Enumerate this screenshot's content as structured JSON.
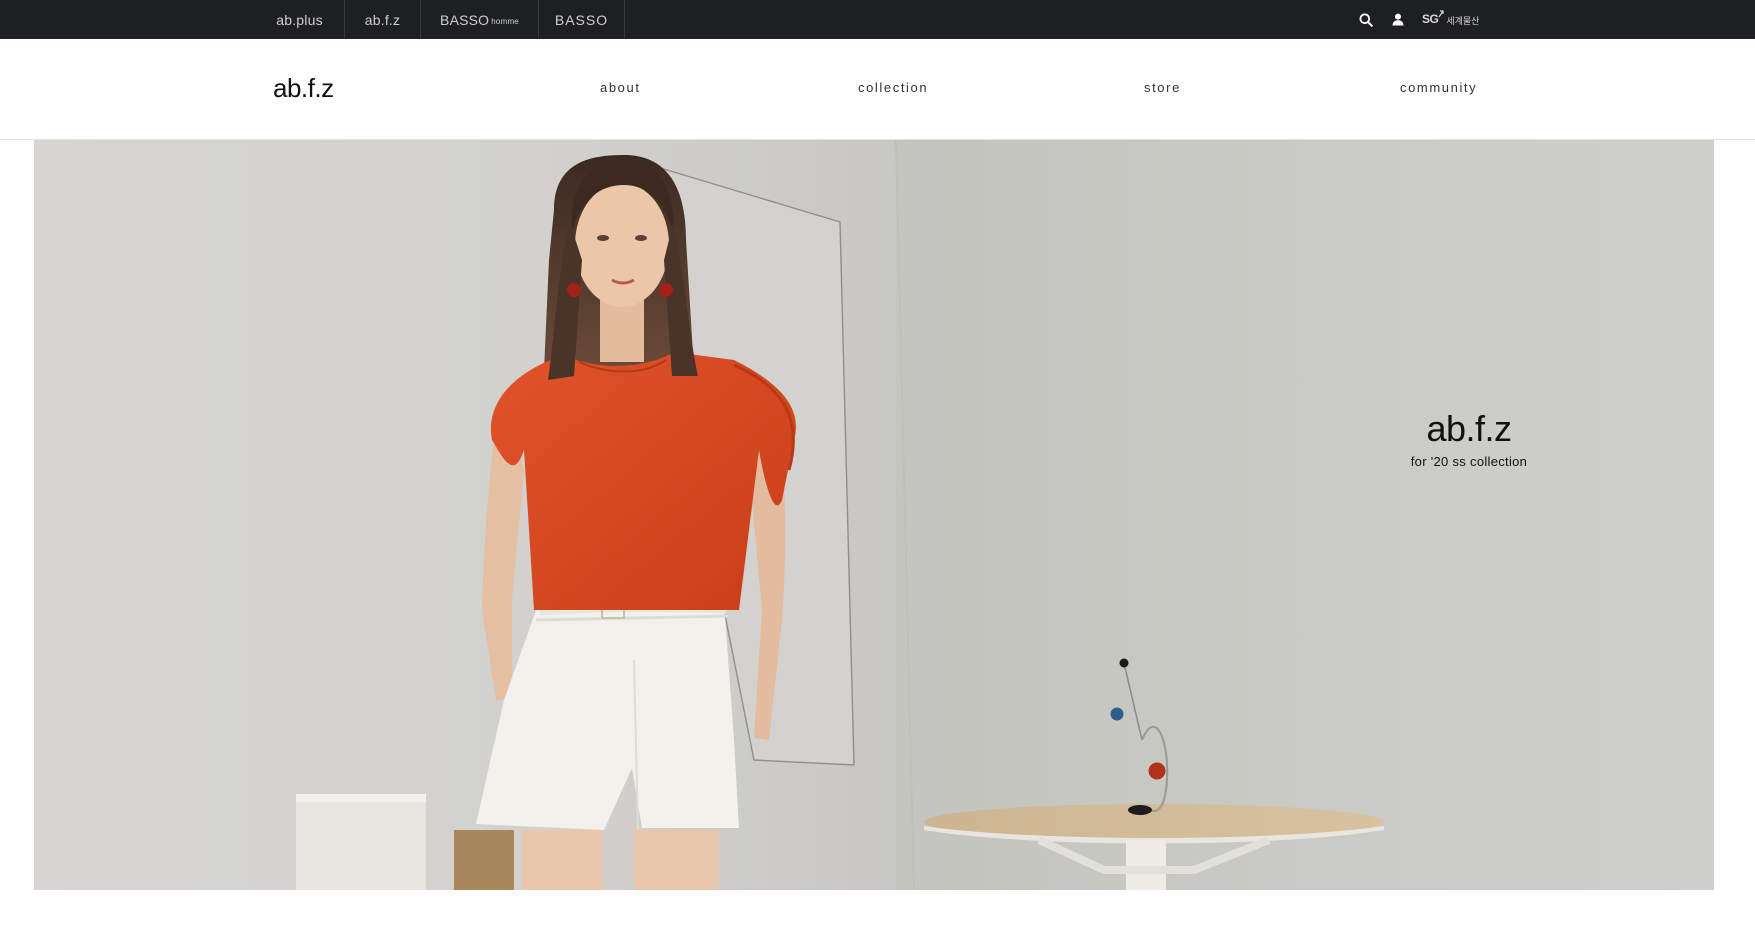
{
  "brand_tabs": [
    {
      "label": "ab.plus"
    },
    {
      "label": "ab.f.z"
    },
    {
      "label": "BASSO",
      "suffix": "homme"
    },
    {
      "label": "BASSO"
    }
  ],
  "utility": {
    "search_icon": "search-icon",
    "user_icon": "user-icon",
    "partner_logo": {
      "main": "SG",
      "sub": "세계물산"
    }
  },
  "header": {
    "logo": "ab.f.z",
    "nav": [
      "about",
      "collection",
      "store",
      "community"
    ]
  },
  "hero": {
    "title": "ab.f.z",
    "subtitle": "for '20 ss collection"
  },
  "colors": {
    "topbar": "#1e1f22",
    "blouse": "#d8471f",
    "background": "#ffffff"
  }
}
